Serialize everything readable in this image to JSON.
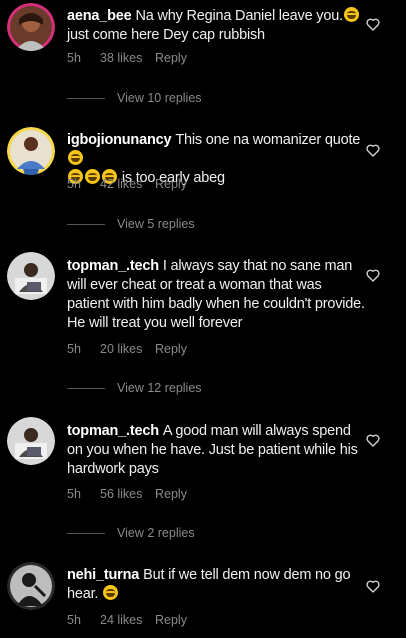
{
  "colors": {
    "background": "#000000",
    "text": "#f0f0f0",
    "muted": "#8a8a8a"
  },
  "comments": [
    {
      "username": "aena_bee",
      "text_parts": [
        "Na why Regina Daniel leave you.",
        " just come here Dey cap rubbish"
      ],
      "time": "5h",
      "likes": "38 likes",
      "reply": "Reply",
      "view_replies": "View 10 replies",
      "avatar_icon": "profile-photo-woman"
    },
    {
      "username": "igbojionunancy",
      "text_parts": [
        "This one na womanizer quote",
        " is too early abeg"
      ],
      "time": "5h",
      "likes": "42 likes",
      "reply": "Reply",
      "view_replies": "View 5 replies",
      "avatar_icon": "profile-photo-woman"
    },
    {
      "username": "topman_.tech",
      "text": "I always say that no sane man will ever cheat or treat a woman that was patient with him badly when he couldn't provide. He will treat you well forever",
      "time": "5h",
      "likes": "20 likes",
      "reply": "Reply",
      "view_replies": "View 12 replies",
      "avatar_icon": "profile-photo-man"
    },
    {
      "username": "topman_.tech",
      "text": "A good man will always spend on you when he have. Just be patient while his hardwork pays",
      "time": "5h",
      "likes": "56 likes",
      "reply": "Reply",
      "view_replies": "View 2 replies",
      "avatar_icon": "profile-photo-man"
    },
    {
      "username": "nehi_turna",
      "text_parts": [
        "But if we tell dem now dem no go hear. "
      ],
      "time": "5h",
      "likes": "24 likes",
      "reply": "Reply",
      "avatar_icon": "profile-photo-bw"
    }
  ]
}
